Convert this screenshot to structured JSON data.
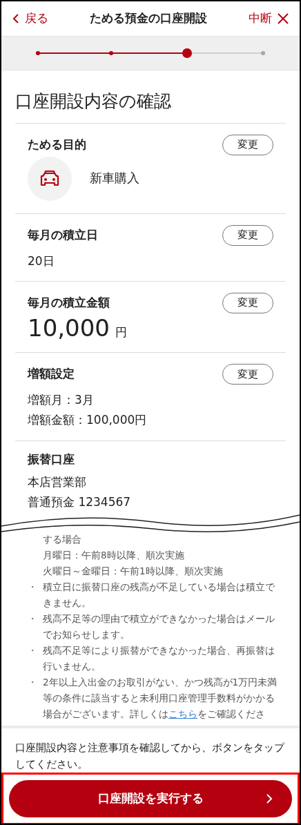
{
  "header": {
    "back": "戻る",
    "title": "ためる預金の口座開設",
    "quit": "中断"
  },
  "steps": [
    {
      "kind": "done"
    },
    {
      "kind": "done"
    },
    {
      "kind": "current"
    },
    {
      "kind": "todo"
    }
  ],
  "page_title": "口座開設内容の確認",
  "sections": [
    {
      "kind": "purpose",
      "label": "ためる目的",
      "button": "変更",
      "value": "新車購入"
    },
    {
      "kind": "text",
      "label": "毎月の積立日",
      "button": "変更",
      "lines": [
        "20日"
      ]
    },
    {
      "kind": "amount",
      "label": "毎月の積立金額",
      "button": "変更",
      "amount": "10,000",
      "unit": "円"
    },
    {
      "kind": "text",
      "label": "増額設定",
      "button": "変更",
      "lines": [
        "増額月：3月",
        "増額金額：100,000円"
      ]
    },
    {
      "kind": "text",
      "label": "振替口座",
      "lines": [
        "本店営業部",
        "普通預金 1234567"
      ]
    }
  ],
  "notes": [
    {
      "kind": "line",
      "text": "する場合"
    },
    {
      "kind": "line",
      "text": "月曜日：午前8時以降、順次実施"
    },
    {
      "kind": "line",
      "text": "火曜日～金曜日：午前1時以降、順次実施"
    },
    {
      "kind": "bullet",
      "text": "積立日に振替口座の残高が不足している場合は積立できません。"
    },
    {
      "kind": "bullet",
      "text": "残高不足等の理由で積立ができなかった場合はメールでお知らせします。"
    },
    {
      "kind": "bullet",
      "text": "残高不足等により振替ができなかった場合、再振替は行いません。"
    },
    {
      "kind": "bullet",
      "text": "2年以上入出金のお取引がない、かつ残高が1万円未満等の条件に該当すると未利用口座管理手数料がかかる場合がございます。詳しくは",
      "link": "こちら",
      "after": "をご確認くださ"
    }
  ],
  "bullet_mark": "・",
  "footer": {
    "message": "口座開設内容と注意事項を確認してから、ボタンをタップしてください。",
    "button": "口座開設を実行する",
    "highlighted": true
  }
}
